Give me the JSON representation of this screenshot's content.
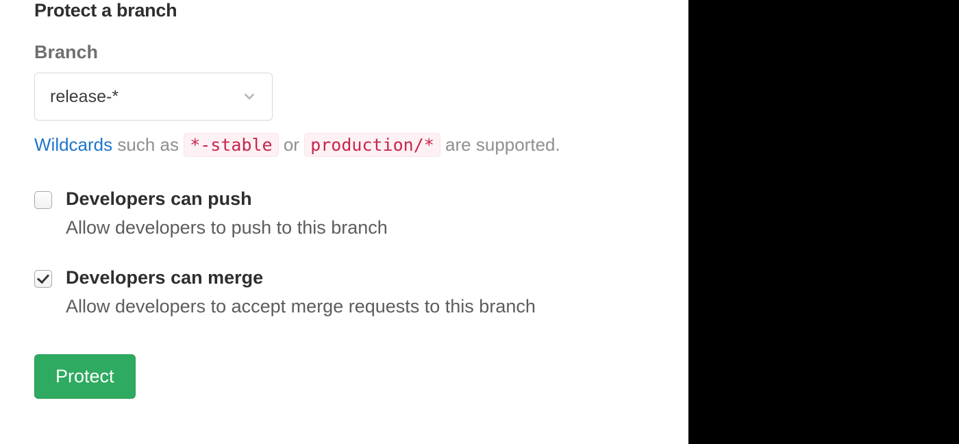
{
  "heading": "Protect a branch",
  "branch": {
    "label": "Branch",
    "selected": "release-*"
  },
  "hint": {
    "link_text": "Wildcards",
    "text_before_code": " such as ",
    "code1": "*-stable",
    "text_mid": " or ",
    "code2": "production/*",
    "text_after": " are supported."
  },
  "checks": {
    "push": {
      "title": "Developers can push",
      "desc": "Allow developers to push to this branch",
      "checked": false
    },
    "merge": {
      "title": "Developers can merge",
      "desc": "Allow developers to accept merge requests to this branch",
      "checked": true
    }
  },
  "submit_label": "Protect"
}
